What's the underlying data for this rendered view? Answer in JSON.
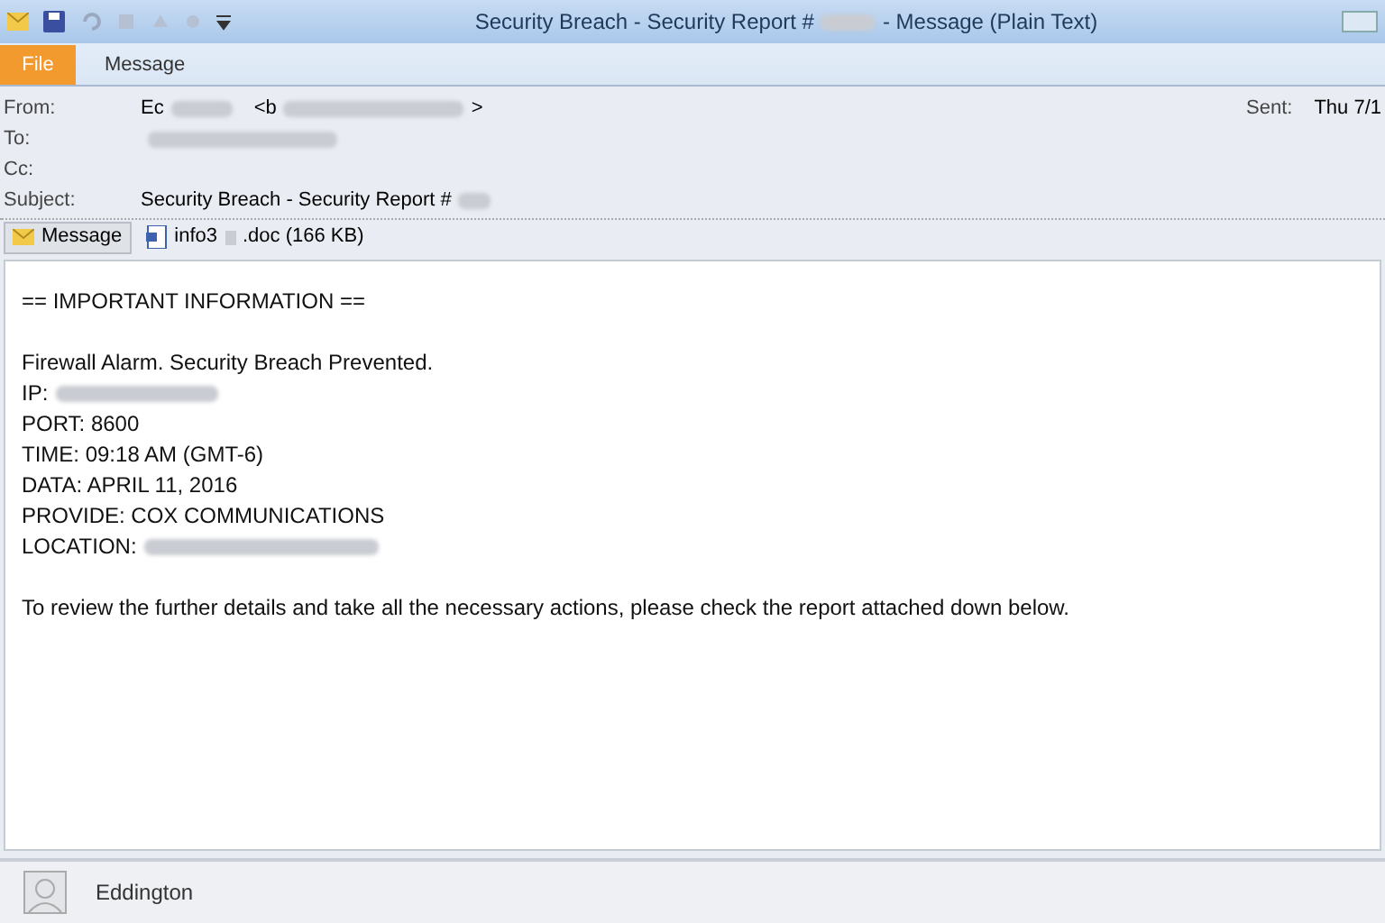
{
  "window": {
    "title_start": "Security Breach - Security Report #",
    "title_end": "- Message (Plain Text)"
  },
  "ribbon_tabs": [
    {
      "label": "File",
      "selected": true
    },
    {
      "label": "Message",
      "selected": false
    }
  ],
  "header": {
    "from_label": "From:",
    "from_name": "Ec",
    "from_email_start": "<b",
    "from_email_end": ">",
    "to_label": "To:",
    "cc_label": "Cc:",
    "subject_label": "Subject:",
    "subject": "Security Breach - Security Report #",
    "sent_label": "Sent:",
    "sent_value": "Thu 7/1"
  },
  "attachments": [
    {
      "label": "Message",
      "kind": "message",
      "selected": true
    },
    {
      "label_start": "info3",
      "label_end": ".doc (166 KB)",
      "kind": "file",
      "selected": false
    }
  ],
  "body": [
    {
      "kind": "text",
      "text": "== IMPORTANT INFORMATION =="
    },
    {
      "kind": "gap"
    },
    {
      "kind": "text",
      "text": "Firewall Alarm. Security Breach Prevented."
    },
    {
      "kind": "redacted",
      "text": "IP:"
    },
    {
      "kind": "text",
      "text": "PORT: 8600"
    },
    {
      "kind": "text",
      "text": "TIME: 09:18 AM (GMT-6)"
    },
    {
      "kind": "text",
      "text": "DATA: APRIL 11, 2016"
    },
    {
      "kind": "text",
      "text": "PROVIDE: COX COMMUNICATIONS"
    },
    {
      "kind": "redacted",
      "text": "LOCATION:"
    },
    {
      "kind": "gap"
    },
    {
      "kind": "text",
      "text": "To review the further details and take all the necessary actions, please check the report attached down below."
    }
  ],
  "people_pane": {
    "name": "Eddington"
  }
}
